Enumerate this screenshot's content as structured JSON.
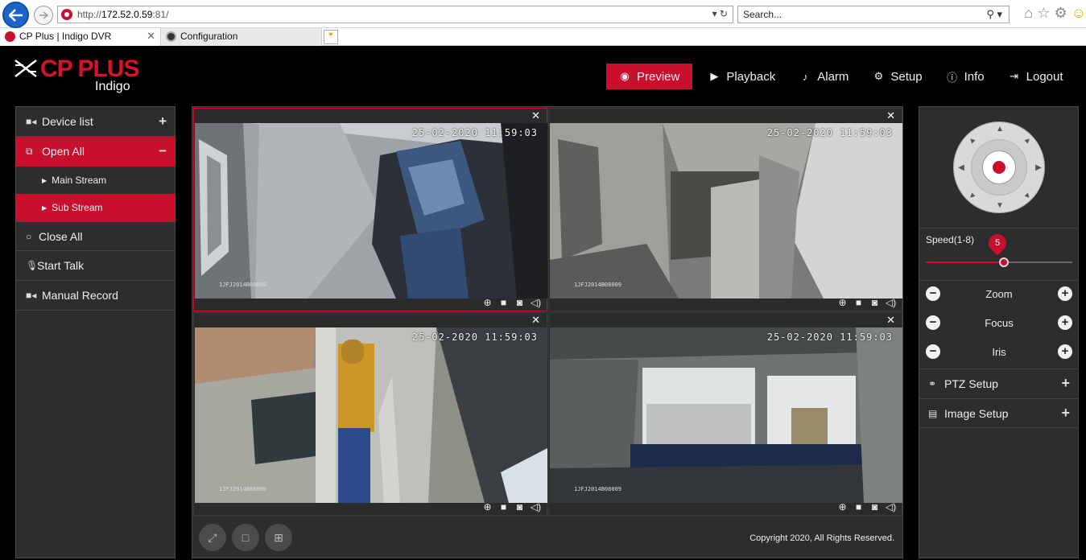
{
  "browser": {
    "url_prefix": "http://",
    "url_host": "172.52.0.59",
    "url_suffix": ":81/",
    "search_placeholder": "Search...",
    "tabs": [
      {
        "label": "CP Plus | Indigo DVR"
      },
      {
        "label": "Configuration"
      }
    ]
  },
  "app": {
    "logo_text": "CP PLUS",
    "logo_sub": "Indigo",
    "nav": [
      {
        "label": "Preview",
        "icon": "eye-icon"
      },
      {
        "label": "Playback",
        "icon": "play-icon"
      },
      {
        "label": "Alarm",
        "icon": "bell-icon"
      },
      {
        "label": "Setup",
        "icon": "gear-icon"
      },
      {
        "label": "Info",
        "icon": "info-icon"
      },
      {
        "label": "Logout",
        "icon": "logout-icon"
      }
    ]
  },
  "left_panel": {
    "device_list": "Device list",
    "open_all": "Open All",
    "main_stream": "Main Stream",
    "sub_stream": "Sub Stream",
    "close_all": "Close All",
    "start_talk": "Start Talk",
    "manual_record": "Manual Record"
  },
  "cameras": [
    {
      "timestamp": "25-02-2020 11:59:03",
      "cam_id": "1JFJ2014B08009"
    },
    {
      "timestamp": "25-02-2020 11:59:03",
      "cam_id": "1JFJ2014B08009"
    },
    {
      "timestamp": "25-02-2020 11:59:03",
      "cam_id": "1JFJ2014B08009"
    },
    {
      "timestamp": "25-02-2020 11:59:03",
      "cam_id": "1JFJ2014B08009"
    }
  ],
  "footer": {
    "copyright": "Copyright 2020, All Rights Reserved."
  },
  "right_panel": {
    "speed_label": "Speed(1-8)",
    "speed_value": "5",
    "speed_min": 1,
    "speed_max": 8,
    "zoom": "Zoom",
    "focus": "Focus",
    "iris": "Iris",
    "ptz_setup": "PTZ Setup",
    "image_setup": "Image Setup"
  },
  "colors": {
    "accent": "#c8102e",
    "panel_bg": "#2d2d2d"
  }
}
